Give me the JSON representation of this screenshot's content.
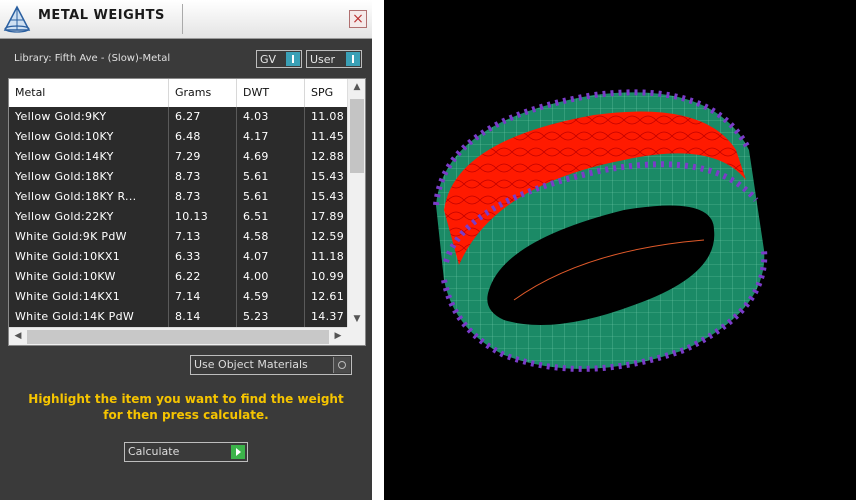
{
  "window": {
    "title": "METAL WEIGHTS",
    "close_label": "×"
  },
  "library": {
    "label": "Library: Fifth Ave - (Slow)-Metal"
  },
  "toggles": [
    {
      "label": "GV"
    },
    {
      "label": "User"
    }
  ],
  "table": {
    "columns": [
      "Metal",
      "Grams",
      "DWT",
      "SPG"
    ],
    "rows": [
      [
        "Yellow Gold:9KY",
        "6.27",
        "4.03",
        "11.08"
      ],
      [
        "Yellow Gold:10KY",
        "6.48",
        "4.17",
        "11.45"
      ],
      [
        "Yellow Gold:14KY",
        "7.29",
        "4.69",
        "12.88"
      ],
      [
        "Yellow Gold:18KY",
        "8.73",
        "5.61",
        "15.43"
      ],
      [
        "Yellow Gold:18KY R...",
        "8.73",
        "5.61",
        "15.43"
      ],
      [
        "Yellow Gold:22KY",
        "10.13",
        "6.51",
        "17.89"
      ],
      [
        "White Gold:9K PdW",
        "7.13",
        "4.58",
        "12.59"
      ],
      [
        "White Gold:10KX1",
        "6.33",
        "4.07",
        "11.18"
      ],
      [
        "White Gold:10KW",
        "6.22",
        "4.00",
        "10.99"
      ],
      [
        "White Gold:14KX1",
        "7.14",
        "4.59",
        "12.61"
      ],
      [
        "White Gold:14K PdW",
        "8.14",
        "5.23",
        "14.37"
      ]
    ]
  },
  "object_materials_label": "Use Object Materials",
  "hint": "Highlight the item you want to find the weight for then press calculate.",
  "calculate_label": "Calculate",
  "icons": {
    "title": "pyramid-weights-icon",
    "close": "close-icon",
    "go": "play-arrow-icon"
  },
  "colors": {
    "panel_bg": "#3a3a3a",
    "row_bg": "#2b2b2b",
    "hint_text": "#f5c400",
    "toggle_accent": "#3aa0b6",
    "calc_accent": "#3cb34a",
    "ring_band": "#1f8f6a",
    "ring_center": "#ff1a00",
    "gems": "#7a3cc8"
  }
}
